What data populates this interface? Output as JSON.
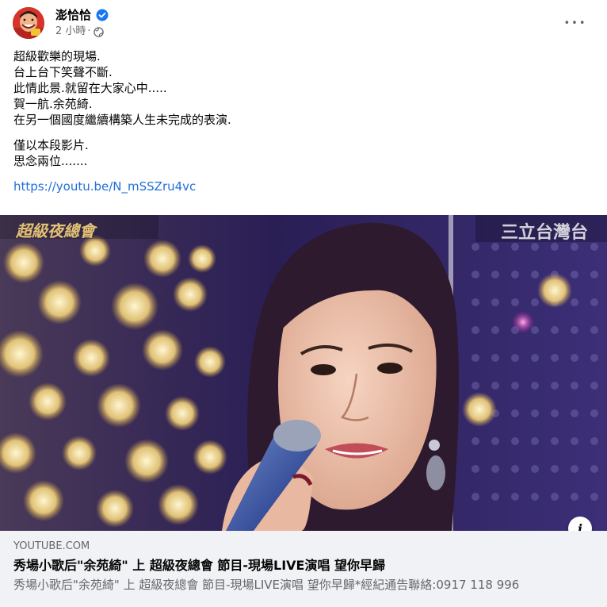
{
  "post": {
    "author": "澎恰恰",
    "time": "2 小時",
    "separator": "·",
    "verified_icon": "verified-badge-icon",
    "privacy_icon": "globe-icon",
    "more_label": "•••",
    "accent_color": "#216fdb",
    "lines": [
      "超級歡樂的現場.",
      "台上台下笑聲不斷.",
      "此情此景.就留在大家心中.....",
      "賀一航.余苑綺.",
      "在另一個國度繼續構築人生未完成的表演.",
      "僅以本段影片.",
      "思念兩位......."
    ],
    "link": "https://youtu.be/N_mSSZru4vc"
  },
  "media": {
    "watermark_left": "超級夜總會",
    "watermark_right": "三立台灣台",
    "info_label": "i"
  },
  "preview": {
    "domain": "YOUTUBE.COM",
    "title": "秀場小歌后\"余苑綺\" 上 超級夜總會 節目-現場LIVE演唱 望你早歸",
    "description": "秀場小歌后\"余苑綺\" 上 超級夜總會 節目-現場LIVE演唱 望你早歸*經紀通告聯絡:0917 118 996"
  }
}
